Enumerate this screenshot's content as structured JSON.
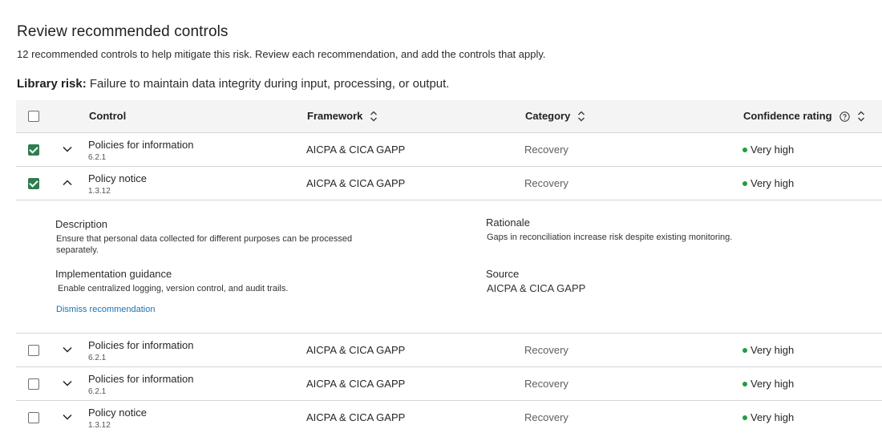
{
  "header": {
    "title": "Review recommended controls",
    "subtitle": "12 recommended controls to help mitigate this risk. Review each recommendation, and add the controls that apply.",
    "risk_label": "Library risk:",
    "risk_text": " Failure to maintain data integrity during input, processing, or output."
  },
  "table": {
    "columns": {
      "control": "Control",
      "framework": "Framework",
      "category": "Category",
      "confidence": "Confidence rating"
    },
    "rows": [
      {
        "checked": true,
        "expanded": false,
        "control": "Policies for information",
        "control_id": "6.2.1",
        "framework": "AICPA & CICA GAPP",
        "category": "Recovery",
        "confidence": "Very high"
      },
      {
        "checked": true,
        "expanded": true,
        "control": "Policy notice",
        "control_id": "1.3.12",
        "framework": "AICPA & CICA GAPP",
        "category": "Recovery",
        "confidence": "Very high"
      },
      {
        "checked": false,
        "expanded": false,
        "control": "Policies for information",
        "control_id": "6.2.1",
        "framework": "AICPA & CICA GAPP",
        "category": "Recovery",
        "confidence": "Very high"
      },
      {
        "checked": false,
        "expanded": false,
        "control": "Policies for information",
        "control_id": "6.2.1",
        "framework": "AICPA & CICA GAPP",
        "category": "Recovery",
        "confidence": "Very high"
      },
      {
        "checked": false,
        "expanded": false,
        "control": "Policy notice",
        "control_id": "1.3.12",
        "framework": "AICPA & CICA GAPP",
        "category": "Recovery",
        "confidence": "Very high"
      }
    ],
    "detail": {
      "description_label": "Description",
      "description_text": "Ensure that personal data collected for different purposes can be processed separately.",
      "guidance_label": "Implementation guidance",
      "guidance_text": "Enable centralized logging, version control, and audit trails.",
      "dismiss_label": "Dismiss recommendation",
      "rationale_label": "Rationale",
      "rationale_text": "Gaps in reconciliation increase risk despite existing monitoring.",
      "source_label": "Source",
      "source_text": "AICPA & CICA GAPP"
    }
  },
  "colors": {
    "accent_green": "#2e7d4f",
    "status_dot": "#1e9e3e",
    "link": "#1a73b5"
  },
  "icons": {
    "sort": "sort-arrows-icon",
    "help": "help-circle-icon",
    "expand": "chevron-down-icon",
    "collapse": "chevron-up-icon"
  }
}
